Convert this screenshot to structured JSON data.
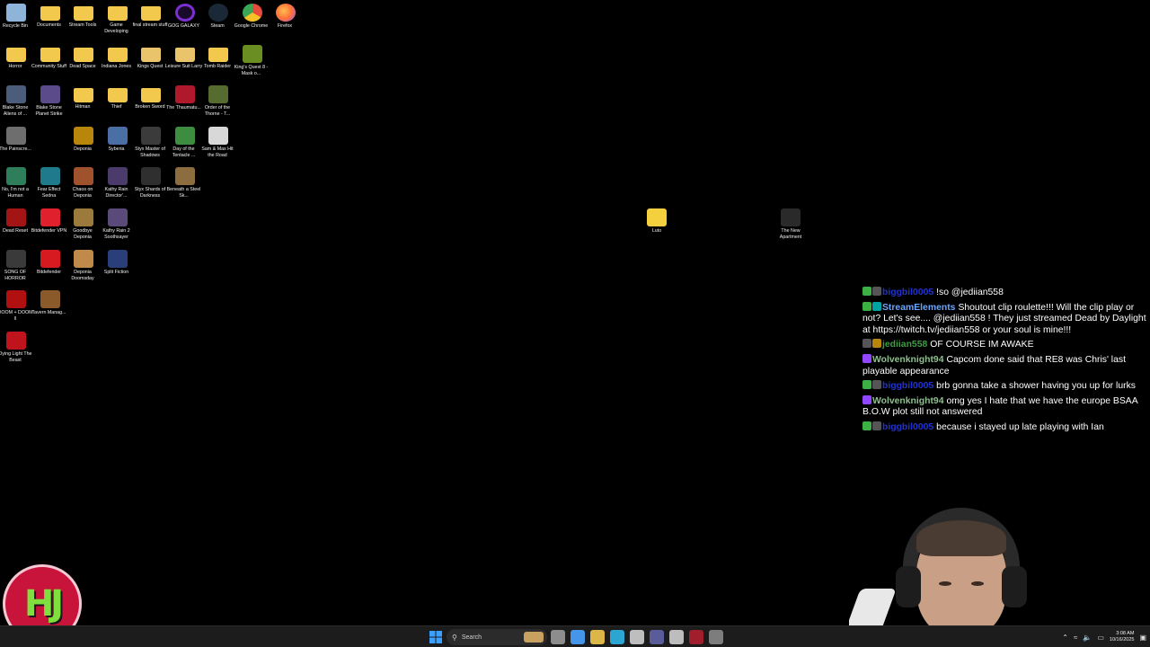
{
  "desktop_icons": [
    {
      "label": "Recycle Bin",
      "icon": "recycle-bin-icon",
      "color": "#8fb4d9",
      "col": 0,
      "row": 0
    },
    {
      "label": "Documents",
      "icon": "folder-icon",
      "color": "#f2c94c",
      "col": 1,
      "row": 0
    },
    {
      "label": "Stream Tools",
      "icon": "folder-icon",
      "color": "#f2c94c",
      "col": 2,
      "row": 0
    },
    {
      "label": "Game Developing",
      "icon": "folder-icon",
      "color": "#f2c94c",
      "col": 3,
      "row": 0
    },
    {
      "label": "final stream stuff",
      "icon": "folder-icon",
      "color": "#f2c94c",
      "col": 4,
      "row": 0
    },
    {
      "label": "GOG GALAXY",
      "icon": "gog-galaxy-icon",
      "color": "#7b2fd1",
      "col": 5,
      "row": 0
    },
    {
      "label": "Steam",
      "icon": "steam-icon",
      "color": "#1b2838",
      "col": 6,
      "row": 0
    },
    {
      "label": "Google Chrome",
      "icon": "chrome-icon",
      "color": "#e84b3c",
      "col": 7,
      "row": 0
    },
    {
      "label": "Firefox",
      "icon": "firefox-icon",
      "color": "#ff7139",
      "col": 8,
      "row": 0
    },
    {
      "label": "Horror",
      "icon": "folder-icon",
      "color": "#f2c94c",
      "col": 0,
      "row": 1
    },
    {
      "label": "Community Stuff",
      "icon": "folder-icon",
      "color": "#f2c94c",
      "col": 1,
      "row": 1
    },
    {
      "label": "Dead Space",
      "icon": "folder-icon",
      "color": "#f2c94c",
      "col": 2,
      "row": 1
    },
    {
      "label": "Indiana Jones",
      "icon": "folder-icon",
      "color": "#f2c94c",
      "col": 3,
      "row": 1
    },
    {
      "label": "Kings Quest",
      "icon": "folder-icon",
      "color": "#e9c46a",
      "col": 4,
      "row": 1
    },
    {
      "label": "Leisure Suit Larry",
      "icon": "folder-icon",
      "color": "#e9c46a",
      "col": 5,
      "row": 1
    },
    {
      "label": "Tomb Raider",
      "icon": "folder-icon",
      "color": "#f2c94c",
      "col": 6,
      "row": 1
    },
    {
      "label": "King's Quest 8 - Mask o...",
      "icon": "game-icon",
      "color": "#6b8e23",
      "col": 7,
      "row": 1
    },
    {
      "label": "Blake Stone Aliens of ...",
      "icon": "game-icon",
      "color": "#4b5d7a",
      "col": 0,
      "row": 2
    },
    {
      "label": "Blake Stone Planet Strike",
      "icon": "game-icon",
      "color": "#5b4b8a",
      "col": 1,
      "row": 2
    },
    {
      "label": "Hitman",
      "icon": "folder-icon",
      "color": "#f2c94c",
      "col": 2,
      "row": 2
    },
    {
      "label": "Thief",
      "icon": "folder-icon",
      "color": "#f2c94c",
      "col": 3,
      "row": 2
    },
    {
      "label": "Broken Sword",
      "icon": "folder-icon",
      "color": "#f2c94c",
      "col": 4,
      "row": 2
    },
    {
      "label": "The Thaumatu...",
      "icon": "game-icon",
      "color": "#b0182b",
      "col": 5,
      "row": 2
    },
    {
      "label": "Order of the Thorne - T...",
      "icon": "game-icon",
      "color": "#556b2f",
      "col": 6,
      "row": 2
    },
    {
      "label": "The Painscre...",
      "icon": "game-icon",
      "color": "#6e6e6e",
      "col": 0,
      "row": 3
    },
    {
      "label": "Deponia",
      "icon": "game-icon",
      "color": "#b8860b",
      "col": 2,
      "row": 3
    },
    {
      "label": "Syberia",
      "icon": "game-icon",
      "color": "#4a6fa5",
      "col": 3,
      "row": 3
    },
    {
      "label": "Styx Master of Shadows",
      "icon": "game-icon",
      "color": "#3b3b3b",
      "col": 4,
      "row": 3
    },
    {
      "label": "Day of the Tentacle ...",
      "icon": "game-icon",
      "color": "#3c8d40",
      "col": 5,
      "row": 3
    },
    {
      "label": "Sam & Max Hit the Road",
      "icon": "game-icon",
      "color": "#d8d8d8",
      "col": 6,
      "row": 3
    },
    {
      "label": "No, I'm not a Human",
      "icon": "game-icon",
      "color": "#2e7d5b",
      "col": 0,
      "row": 4
    },
    {
      "label": "Fear Effect Sedna",
      "icon": "game-icon",
      "color": "#1f7a8c",
      "col": 1,
      "row": 4
    },
    {
      "label": "Chaos on Deponia",
      "icon": "game-icon",
      "color": "#a0522d",
      "col": 2,
      "row": 4
    },
    {
      "label": "Kathy Rain Director'...",
      "icon": "game-icon",
      "color": "#4b3b6b",
      "col": 3,
      "row": 4
    },
    {
      "label": "Styx Shards of Darkness",
      "icon": "game-icon",
      "color": "#2f2f2f",
      "col": 4,
      "row": 4
    },
    {
      "label": "Beneath a Steel Sk...",
      "icon": "game-icon",
      "color": "#8b6d3f",
      "col": 5,
      "row": 4
    },
    {
      "label": "Dead Reset",
      "icon": "game-icon",
      "color": "#a31515",
      "col": 0,
      "row": 5
    },
    {
      "label": "Bitdefender VPN",
      "icon": "bitdefender-vpn-icon",
      "color": "#e0202d",
      "col": 1,
      "row": 5
    },
    {
      "label": "Goodbye Deponia",
      "icon": "game-icon",
      "color": "#9c7a3c",
      "col": 2,
      "row": 5
    },
    {
      "label": "Kathy Rain 2 Soothsayer",
      "icon": "game-icon",
      "color": "#5a4a7a",
      "col": 3,
      "row": 5
    },
    {
      "label": "SONG OF HORROR",
      "icon": "game-icon",
      "color": "#3a3a3a",
      "col": 0,
      "row": 6
    },
    {
      "label": "Bitdefender",
      "icon": "bitdefender-icon",
      "color": "#d71920",
      "col": 1,
      "row": 6
    },
    {
      "label": "Deponia Doomsday",
      "icon": "game-icon",
      "color": "#c08a4a",
      "col": 2,
      "row": 6
    },
    {
      "label": "Split Fiction",
      "icon": "game-icon",
      "color": "#2a3f7a",
      "col": 3,
      "row": 6
    },
    {
      "label": "DOOM + DOOM II",
      "icon": "game-icon",
      "color": "#b01010",
      "col": 0,
      "row": 7
    },
    {
      "label": "Tavern Manag...",
      "icon": "game-icon",
      "color": "#8b5a2b",
      "col": 1,
      "row": 7
    },
    {
      "label": "Dying Light The Beast",
      "icon": "game-icon",
      "color": "#c0141c",
      "col": 0,
      "row": 8
    }
  ],
  "loose_icons": [
    {
      "label": "Luto",
      "icon": "luto-icon",
      "color": "#f4d03f",
      "slot": "luto"
    },
    {
      "label": "The New Apartment",
      "icon": "game-icon",
      "color": "#2a2a2a",
      "slot": "apartment"
    }
  ],
  "chat": [
    {
      "user": "biggbil0005",
      "user_color": "#2233cc",
      "badges": [
        "#3cb043",
        "#555555"
      ],
      "text": "!so @jediian558"
    },
    {
      "user": "StreamElements",
      "user_color": "#6aa6ff",
      "badges": [
        "#3cb043",
        "#00a3a3"
      ],
      "text": "Shoutout clip roulette!!! Will the clip play or not? Let's see.... @jediian558 ! They just streamed Dead by Daylight at https://twitch.tv/jediian558 or your soul is mine!!!"
    },
    {
      "user": "jediian558",
      "user_color": "#3aa040",
      "badges": [
        "#555555",
        "#b8860b"
      ],
      "text": "OF COURSE IM AWAKE"
    },
    {
      "user": "Wolvenknight94",
      "user_color": "#8fbf8f",
      "badges": [
        "#9146ff"
      ],
      "text": "Capcom done said that RE8 was Chris' last playable appearance"
    },
    {
      "user": "biggbil0005",
      "user_color": "#2233cc",
      "badges": [
        "#3cb043",
        "#555555"
      ],
      "text": "brb gonna take a shower having you up for lurks"
    },
    {
      "user": "Wolvenknight94",
      "user_color": "#8fbf8f",
      "badges": [
        "#9146ff"
      ],
      "text": "omg yes I hate that we have the europe BSAA B.O.W plot still not answered"
    },
    {
      "user": "biggbil0005",
      "user_color": "#2233cc",
      "badges": [
        "#3cb043",
        "#555555"
      ],
      "text": "because i stayed up late playing with Ian"
    }
  ],
  "logo": {
    "text": "HJ"
  },
  "taskbar": {
    "search_placeholder": "Search",
    "apps": [
      {
        "name": "task-view-icon",
        "color": "#9a9a9a"
      },
      {
        "name": "copilot-icon",
        "color": "#4aa3ff"
      },
      {
        "name": "file-explorer-icon",
        "color": "#f2c94c"
      },
      {
        "name": "edge-icon",
        "color": "#2fb5e8"
      },
      {
        "name": "lightbulb-app-icon",
        "color": "#d0d0d0"
      },
      {
        "name": "teams-icon",
        "color": "#6264a7"
      },
      {
        "name": "calendar-app-icon",
        "color": "#cfcfcf"
      },
      {
        "name": "obs-icon",
        "color": "#b02030"
      },
      {
        "name": "store-icon",
        "color": "#888888"
      }
    ],
    "clock_time": "3:08 AM",
    "clock_date": "10/16/2025"
  }
}
